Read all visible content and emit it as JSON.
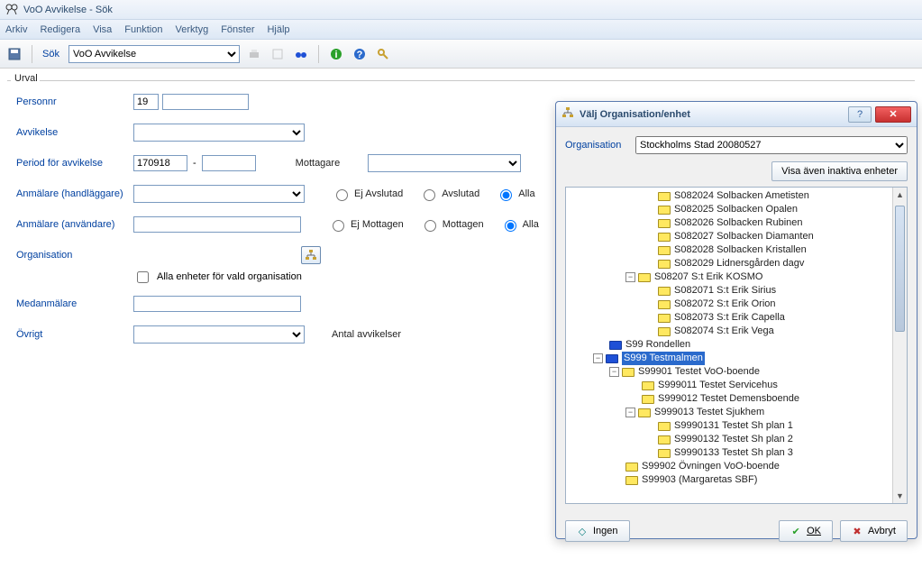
{
  "window": {
    "title": "VoO Avvikelse - Sök"
  },
  "menu": {
    "arkiv": "Arkiv",
    "redigera": "Redigera",
    "visa": "Visa",
    "funktion": "Funktion",
    "verktyg": "Verktyg",
    "fonster": "Fönster",
    "hjalp": "Hjälp"
  },
  "toolbar": {
    "sok_label": "Sök",
    "combo_selected": "VoO Avvikelse"
  },
  "urval": {
    "group_label": "Urval",
    "personnr_label": "Personnr",
    "personnr_prefix": "19",
    "avvikelse_label": "Avvikelse",
    "period_label": "Period för avvikelse",
    "period_from": "170918",
    "period_sep": "-",
    "mottagare_label": "Mottagare",
    "anmalare_hand_label": "Anmälare (handläggare)",
    "anmalare_anv_label": "Anmälare (användare)",
    "avslut_ej": "Ej Avslutad",
    "avslut_av": "Avslutad",
    "avslut_alla": "Alla",
    "mott_ej": "Ej Mottagen",
    "mott_m": "Mottagen",
    "mott_alla": "Alla",
    "org_label": "Organisation",
    "org_chk_label": "Alla enheter för vald organisation",
    "medanmalare_label": "Medanmälare",
    "ovrigt_label": "Övrigt",
    "antal_label": "Antal avvikelser"
  },
  "dialog": {
    "title": "Välj Organisation/enhet",
    "org_label": "Organisation",
    "org_selected": "Stockholms Stad 20080527",
    "inactive_btn": "Visa även inaktiva enheter",
    "tree": [
      {
        "depth": 5,
        "code": "S082024",
        "name": "Solbacken Ametisten"
      },
      {
        "depth": 5,
        "code": "S082025",
        "name": "Solbacken Opalen"
      },
      {
        "depth": 5,
        "code": "S082026",
        "name": "Solbacken Rubinen"
      },
      {
        "depth": 5,
        "code": "S082027",
        "name": "Solbacken Diamanten"
      },
      {
        "depth": 5,
        "code": "S082028",
        "name": "Solbacken Kristallen"
      },
      {
        "depth": 5,
        "code": "S082029",
        "name": "Lidnersgården dagv"
      },
      {
        "depth": 4,
        "exp": "-",
        "code": "S08207",
        "name": "S:t Erik KOSMO"
      },
      {
        "depth": 5,
        "code": "S082071",
        "name": "S:t Erik Sirius"
      },
      {
        "depth": 5,
        "code": "S082072",
        "name": "S:t Erik Orion"
      },
      {
        "depth": 5,
        "code": "S082073",
        "name": "S:t Erik Capella"
      },
      {
        "depth": 5,
        "code": "S082074",
        "name": "S:t Erik Vega"
      },
      {
        "depth": 2,
        "blue": true,
        "code": "S99",
        "name": "Rondellen"
      },
      {
        "depth": 2,
        "exp": "-",
        "blue": true,
        "sel": true,
        "code": "S999",
        "name": "Testmalmen"
      },
      {
        "depth": 3,
        "exp": "-",
        "code": "S99901",
        "name": "Testet VoO-boende"
      },
      {
        "depth": 4,
        "code": "S999011",
        "name": "Testet Servicehus"
      },
      {
        "depth": 4,
        "code": "S999012",
        "name": "Testet Demensboende"
      },
      {
        "depth": 4,
        "exp": "-",
        "code": "S999013",
        "name": "Testet Sjukhem"
      },
      {
        "depth": 5,
        "code": "S9990131",
        "name": "Testet Sh plan 1"
      },
      {
        "depth": 5,
        "code": "S9990132",
        "name": "Testet Sh plan 2"
      },
      {
        "depth": 5,
        "code": "S9990133",
        "name": "Testet Sh plan 3"
      },
      {
        "depth": 3,
        "code": "S99902",
        "name": "Övningen VoO-boende"
      },
      {
        "depth": 3,
        "code": "S99903",
        "name": "(Margaretas SBF)"
      }
    ],
    "btn_ingen": "Ingen",
    "btn_ok": "OK",
    "btn_avbryt": "Avbryt"
  }
}
